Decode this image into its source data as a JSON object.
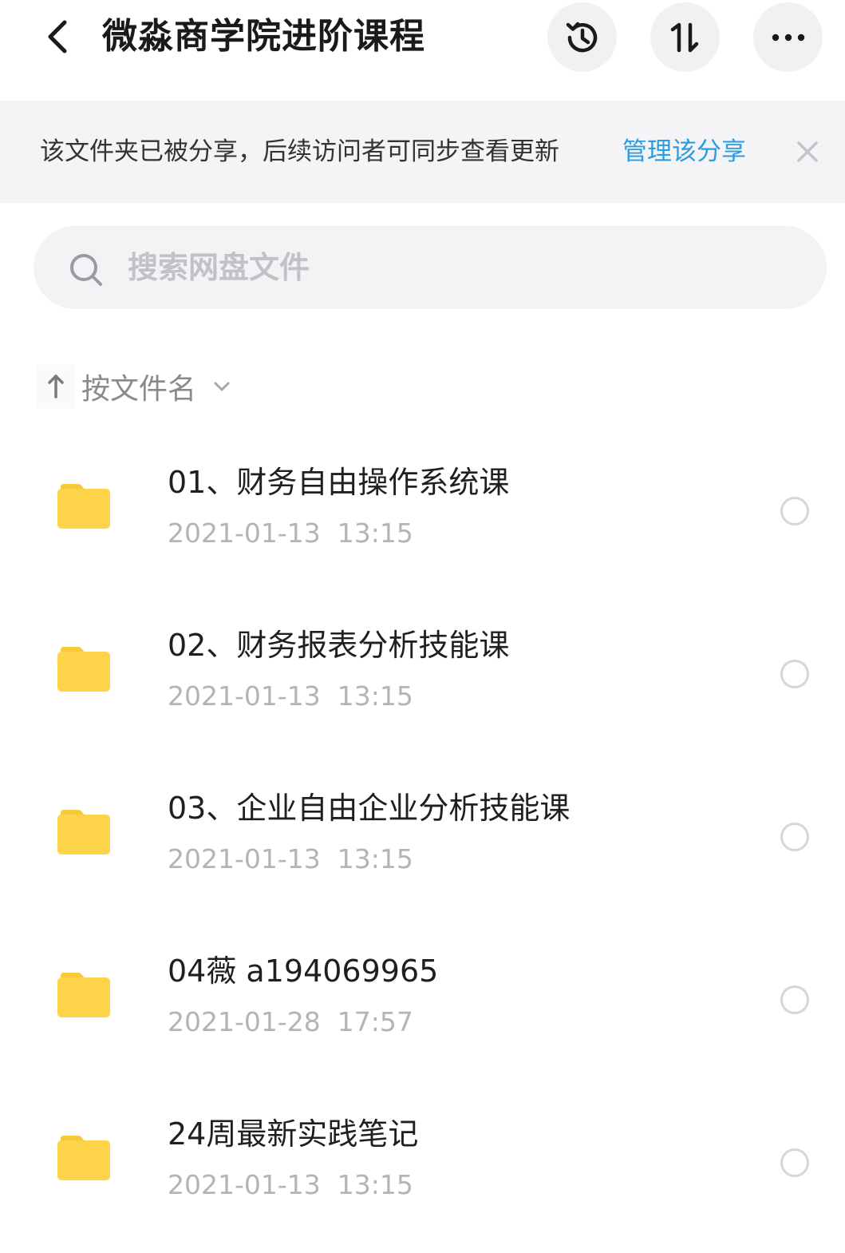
{
  "header": {
    "title": "微淼商学院进阶课程",
    "back_icon": "chevron-left-icon",
    "history_icon": "history-icon",
    "sort_icon": "sort-icon",
    "more_icon": "more-icon"
  },
  "share_banner": {
    "text": "该文件夹已被分享，后续访问者可同步查看更新",
    "link_label": "管理该分享",
    "close_icon": "close-icon",
    "link_color": "#2a9ddf"
  },
  "search": {
    "placeholder": "搜索网盘文件",
    "icon": "search-icon"
  },
  "sort": {
    "label": "按文件名",
    "direction_icon": "arrow-up-icon",
    "dropdown_icon": "chevron-down-icon"
  },
  "files": [
    {
      "name": "01、财务自由操作系统课",
      "date": "2021-01-13  13:15",
      "icon": "folder-icon"
    },
    {
      "name": "02、财务报表分析技能课",
      "date": "2021-01-13  13:15",
      "icon": "folder-icon"
    },
    {
      "name": "03、企业自由企业分析技能课",
      "date": "2021-01-13  13:15",
      "icon": "folder-icon"
    },
    {
      "name": "04薇 a194069965",
      "date": "2021-01-28  17:57",
      "icon": "folder-icon"
    },
    {
      "name": "24周最新实践笔记",
      "date": "2021-01-13  13:15",
      "icon": "folder-icon"
    }
  ],
  "colors": {
    "folder": "#fdd34a",
    "folder_tab": "#f7c83a",
    "accent": "#2a9ddf"
  }
}
